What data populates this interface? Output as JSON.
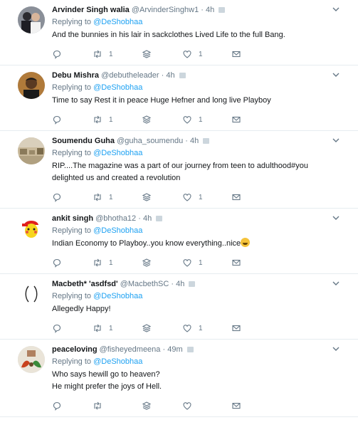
{
  "tweets": [
    {
      "name": "Arvinder Singh walia",
      "handle": "@ArvinderSinghw1",
      "time": "4h",
      "replying_label": "Replying to",
      "replying_to": "@DeShobhaa",
      "lines": [
        "And the bunnies in his lair in sackclothes Lived Life to the full Bang."
      ],
      "retweets": "1",
      "likes": "1"
    },
    {
      "name": "Debu Mishra",
      "handle": "@debutheleader",
      "time": "4h",
      "replying_label": "Replying to",
      "replying_to": "@DeShobhaa",
      "lines": [
        "Time to say Rest it in peace Huge Hefner and long live Playboy"
      ],
      "retweets": "1",
      "likes": "1"
    },
    {
      "name": "Soumendu Guha",
      "handle": "@guha_soumendu",
      "time": "4h",
      "replying_label": "Replying to",
      "replying_to": "@DeShobhaa",
      "lines": [
        "RIP....The magazine was a part of our journey from teen to adulthood#you",
        "delighted us and created a revolution"
      ],
      "retweets": "1",
      "likes": "1"
    },
    {
      "name": "ankit singh",
      "handle": "@bhotha12",
      "time": "4h",
      "replying_label": "Replying to",
      "replying_to": "@DeShobhaa",
      "lines": [
        "Indian Economy to Playboy..you know everything..nice"
      ],
      "emoji": "grinning-emoji",
      "retweets": "1",
      "likes": "1"
    },
    {
      "name": "Macbeth* 'asdfsd'",
      "handle": "@MacbethSC",
      "time": "4h",
      "replying_label": "Replying to",
      "replying_to": "@DeShobhaa",
      "lines": [
        "Allegedly Happy!"
      ],
      "retweets": "1",
      "likes": "1"
    },
    {
      "name": "peaceloving",
      "handle": "@fisheyedmeena",
      "time": "49m",
      "replying_label": "Replying to",
      "replying_to": "@DeShobhaa",
      "lines": [
        "Who says hewill go to heaven?",
        "He might prefer the joys of Hell."
      ],
      "retweets": "",
      "likes": ""
    }
  ],
  "icons": {
    "reply": "reply-icon",
    "retweet": "retweet-icon",
    "moderate": "moderate-icon",
    "like": "heart-icon",
    "dm": "envelope-icon",
    "caret": "chevron-down-icon"
  },
  "colors": {
    "text": "#14171a",
    "muted": "#657786",
    "link": "#1da1f2",
    "divider": "#e6ecf0"
  }
}
